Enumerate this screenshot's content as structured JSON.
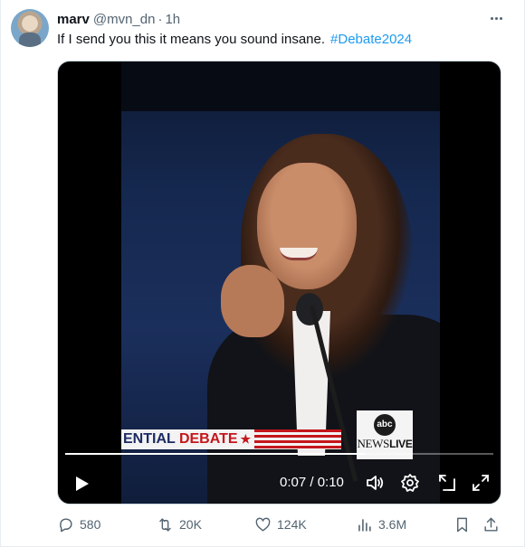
{
  "post": {
    "author_name": "marv",
    "author_handle": "@mvn_dn",
    "separator": "·",
    "timestamp": "1h",
    "text": "If I send you this it means you sound insane.",
    "hashtag": "#Debate2024"
  },
  "video": {
    "banner_text_blue": "ENTIAL ",
    "banner_text_red": "DEBATE",
    "banner_star": "★",
    "logo_abc": "abc",
    "logo_news": "NEWS",
    "logo_live": "LIVE",
    "time_display": "0:07 / 0:10",
    "progress": 0.7,
    "icons": [
      "play-icon",
      "volume-icon",
      "settings-icon",
      "popout-icon",
      "fullscreen-icon"
    ]
  },
  "actions": {
    "replies": "580",
    "reposts": "20K",
    "likes": "124K",
    "views": "3.6M"
  },
  "colors": {
    "accent": "#1d9bf0",
    "muted": "#536471",
    "text": "#0f1419"
  }
}
